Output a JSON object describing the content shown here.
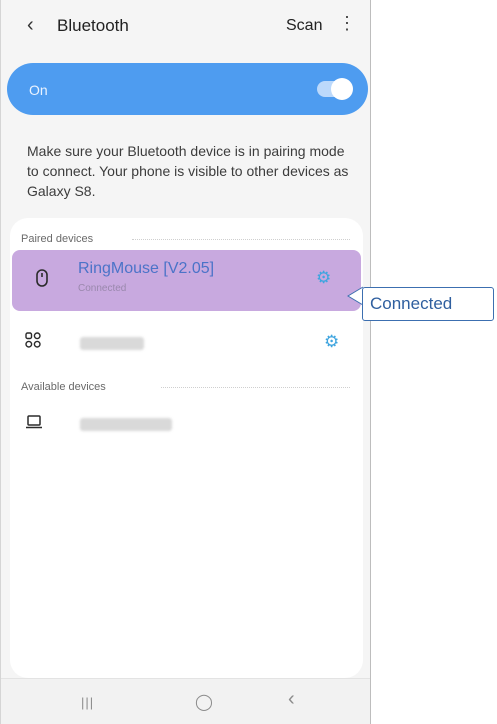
{
  "header": {
    "back_icon": "‹",
    "title": "Bluetooth",
    "scan_label": "Scan",
    "more_icon": "⋮"
  },
  "toggle": {
    "label": "On",
    "state": true,
    "bar_color": "#4e9cf0"
  },
  "hint_text": "Make sure your Bluetooth device is in pairing mode to connect. Your phone is visible to other devices as Galaxy S8.",
  "paired_section": {
    "title": "Paired devices",
    "devices": [
      {
        "name": "RingMouse [V2.05]",
        "status": "Connected",
        "icon": "mouse-icon",
        "highlighted": true
      },
      {
        "name": "",
        "status": "",
        "icon": "grid-device-icon"
      }
    ]
  },
  "available_section": {
    "title": "Available devices",
    "devices": [
      {
        "name": "",
        "icon": "laptop-icon"
      }
    ]
  },
  "navbar": {
    "recent_glyph": "|||",
    "home_glyph": "◯",
    "back_glyph": "‹"
  },
  "annotation": {
    "label": "Connected",
    "highlight_color": "#c8a9df"
  }
}
